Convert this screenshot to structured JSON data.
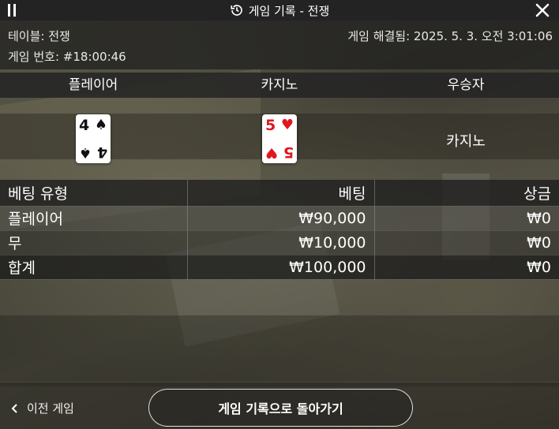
{
  "header": {
    "title": "게임 기록 - 전쟁"
  },
  "info": {
    "table": "테이블: 전쟁",
    "round": "게임 번호: #18:00:46",
    "resolved": "게임 해결됨: 2025. 5. 3. 오전 3:01:06"
  },
  "results": {
    "columns": [
      "플레이어",
      "카지노",
      "우승자"
    ],
    "player_card": {
      "rank": "4",
      "suit": "♠",
      "color": "#111111"
    },
    "dealer_card": {
      "rank": "5",
      "suit": "♥",
      "color": "#e0171f"
    },
    "winner": "카지노"
  },
  "bets": {
    "headers": [
      "베팅 유형",
      "베팅",
      "상금"
    ],
    "rows": [
      {
        "type": "플레이어",
        "bet": "₩90,000",
        "payout": "₩0"
      },
      {
        "type": "무",
        "bet": "₩10,000",
        "payout": "₩0"
      }
    ],
    "total": {
      "type": "합계",
      "bet": "₩100,000",
      "payout": "₩0"
    }
  },
  "footer": {
    "prev_game": "이전 게임",
    "back_button": "게임 기록으로 돌아가기"
  }
}
